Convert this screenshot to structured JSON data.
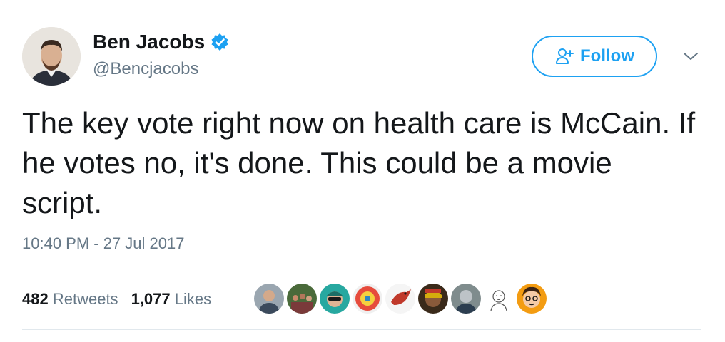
{
  "user": {
    "display_name": "Ben Jacobs",
    "handle": "@Bencjacobs",
    "verified": true
  },
  "follow_button": {
    "label": "Follow",
    "icon": "add-user-icon"
  },
  "caret_icon": "chevron-down-icon",
  "tweet": {
    "text": "The key vote right now on health care is McCain. If he votes no, it's done. This could be a movie script.",
    "timestamp": "10:40 PM - 27 Jul 2017"
  },
  "stats": {
    "retweets_count": "482",
    "retweets_label": "Retweets",
    "likes_count": "1,077",
    "likes_label": "Likes"
  },
  "colors": {
    "accent": "#1da1f2",
    "text": "#14171a",
    "secondary_text": "#657786",
    "divider": "#e1e8ed"
  }
}
